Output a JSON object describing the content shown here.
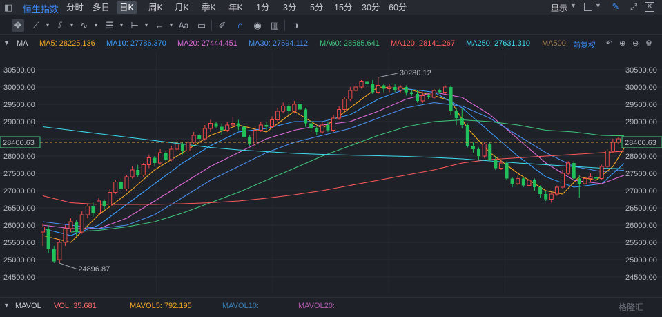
{
  "topbar": {
    "symbol": "恒生指数",
    "tabs": [
      "分时",
      "多日",
      "日K",
      "周K",
      "月K",
      "季K",
      "年K",
      "1分",
      "3分",
      "5分",
      "15分",
      "30分",
      "60分"
    ],
    "active_tab": "日K",
    "display_label": "显示"
  },
  "legend": {
    "ma_label": "MA",
    "ma5": "MA5: 28225.136",
    "ma10": "MA10: 27786.370",
    "ma20": "MA20: 27444.451",
    "ma30": "MA30: 27594.112",
    "ma60": "MA60: 28585.641",
    "ma120": "MA120: 28141.267",
    "ma250": "MA250: 27631.310",
    "ma500": "MA500:",
    "adjust": "前复权",
    "colors": {
      "ma5": "#f5a623",
      "ma10": "#3a9dff",
      "ma20": "#e06ad9",
      "ma30": "#4a8ff0",
      "ma60": "#3ec47a",
      "ma120": "#ff5a5a",
      "ma250": "#3ddcf0",
      "ma500": "#a08050",
      "up": "#ef4a4a",
      "down": "#21c05a",
      "adjust": "#3b8cff"
    }
  },
  "volume_legend": {
    "label": "MAVOL",
    "vol": "VOL: 35.681",
    "mavol5": "MAVOL5: 792.195",
    "mavol10": "MAVOL10:",
    "mavol20": "MAVOL20:"
  },
  "watermark": "格隆汇",
  "chart_data": {
    "type": "candlestick",
    "y_ticks": [
      "30500.00",
      "30000.00",
      "29500.00",
      "29000.00",
      "28500.00",
      "28000.00",
      "27500.00",
      "27000.00",
      "26500.00",
      "26000.00",
      "25500.00",
      "25000.00",
      "24500.00"
    ],
    "ylim": [
      24300,
      30700
    ],
    "current_price": "28400.63",
    "high_label": "30280.12",
    "low_label": "24896.87",
    "candles": [
      [
        25800,
        25950,
        25400,
        26050
      ],
      [
        25900,
        25300,
        25200,
        26000
      ],
      [
        25300,
        24950,
        24900,
        25400
      ],
      [
        25000,
        25500,
        24896.87,
        25600
      ],
      [
        25500,
        25900,
        25400,
        26000
      ],
      [
        25900,
        26100,
        25800,
        26200
      ],
      [
        26100,
        25800,
        25700,
        26150
      ],
      [
        25800,
        26300,
        25750,
        26400
      ],
      [
        26300,
        26550,
        26200,
        26600
      ],
      [
        26550,
        26350,
        26250,
        26650
      ],
      [
        26350,
        26700,
        26300,
        26800
      ],
      [
        26700,
        26550,
        26450,
        26750
      ],
      [
        26550,
        26950,
        26500,
        27050
      ],
      [
        26950,
        27250,
        26900,
        27300
      ],
      [
        27250,
        27050,
        26950,
        27350
      ],
      [
        27050,
        27400,
        27000,
        27450
      ],
      [
        27400,
        27600,
        27350,
        27700
      ],
      [
        27600,
        27450,
        27400,
        27750
      ],
      [
        27450,
        27750,
        27400,
        27800
      ],
      [
        27750,
        27950,
        27650,
        28050
      ],
      [
        27950,
        27800,
        27700,
        28000
      ],
      [
        27800,
        28100,
        27750,
        28200
      ],
      [
        28100,
        27900,
        27850,
        28150
      ],
      [
        27900,
        28200,
        27850,
        28300
      ],
      [
        28200,
        28350,
        28150,
        28450
      ],
      [
        28350,
        28150,
        28050,
        28400
      ],
      [
        28150,
        28400,
        28100,
        28500
      ],
      [
        28400,
        28600,
        28350,
        28700
      ],
      [
        28600,
        28500,
        28400,
        28650
      ],
      [
        28500,
        28800,
        28450,
        28900
      ],
      [
        28800,
        28950,
        28700,
        29050
      ],
      [
        28950,
        28850,
        28800,
        29000
      ],
      [
        28850,
        28750,
        28600,
        28950
      ],
      [
        28750,
        28900,
        28700,
        29000
      ],
      [
        28900,
        28950,
        28850,
        29150
      ],
      [
        28950,
        28850,
        28750,
        29050
      ],
      [
        28850,
        28550,
        28500,
        28900
      ],
      [
        28550,
        28350,
        28300,
        28600
      ],
      [
        28350,
        28750,
        28300,
        28850
      ],
      [
        28750,
        28900,
        28700,
        29000
      ],
      [
        28900,
        28850,
        28750,
        29000
      ],
      [
        28850,
        29050,
        28800,
        29150
      ],
      [
        29050,
        29300,
        29000,
        29400
      ],
      [
        29300,
        29450,
        29250,
        29550
      ],
      [
        29450,
        29300,
        29200,
        29500
      ],
      [
        29300,
        29500,
        29250,
        29600
      ],
      [
        29500,
        29350,
        29050,
        29550
      ],
      [
        29350,
        28950,
        28850,
        29400
      ],
      [
        28950,
        28800,
        28700,
        29050
      ],
      [
        28800,
        28700,
        28600,
        28850
      ],
      [
        28700,
        28900,
        28650,
        29000
      ],
      [
        28900,
        28750,
        28700,
        29000
      ],
      [
        28750,
        29100,
        28700,
        29200
      ],
      [
        29100,
        29350,
        29050,
        29450
      ],
      [
        29350,
        29650,
        29300,
        29700
      ],
      [
        29650,
        29900,
        29600,
        30000
      ],
      [
        29900,
        30000,
        29850,
        30100
      ],
      [
        30000,
        30150,
        29950,
        30200
      ],
      [
        30150,
        30100,
        30050,
        30250
      ],
      [
        30100,
        29850,
        29800,
        30200
      ],
      [
        29850,
        30050,
        29800,
        30280.12
      ],
      [
        30050,
        29950,
        29850,
        30100
      ],
      [
        29950,
        30000,
        29850,
        30100
      ],
      [
        30000,
        29900,
        29850,
        30100
      ],
      [
        29900,
        30000,
        29850,
        30050
      ],
      [
        30000,
        29850,
        29750,
        30050
      ],
      [
        29850,
        29800,
        29750,
        29900
      ],
      [
        29800,
        29600,
        29550,
        29900
      ],
      [
        29600,
        29750,
        29550,
        29850
      ],
      [
        29750,
        29700,
        29650,
        29800
      ],
      [
        29700,
        29900,
        29650,
        29950
      ],
      [
        29900,
        29850,
        29800,
        29950
      ],
      [
        29850,
        30000,
        29800,
        30050
      ],
      [
        30000,
        29300,
        29200,
        30050
      ],
      [
        29300,
        29100,
        28900,
        29400
      ],
      [
        29100,
        28900,
        28800,
        29400
      ],
      [
        28900,
        28300,
        28250,
        28950
      ],
      [
        28300,
        28200,
        28100,
        28400
      ],
      [
        28200,
        28000,
        27900,
        28250
      ],
      [
        28000,
        28350,
        27950,
        28400
      ],
      [
        28350,
        27900,
        27850,
        28400
      ],
      [
        27900,
        27650,
        27600,
        28000
      ],
      [
        27650,
        27800,
        27600,
        27900
      ],
      [
        27800,
        27350,
        27300,
        27850
      ],
      [
        27350,
        27200,
        27100,
        27400
      ],
      [
        27200,
        27350,
        27150,
        27450
      ],
      [
        27350,
        27150,
        27100,
        27400
      ],
      [
        27150,
        27300,
        27100,
        27350
      ],
      [
        27300,
        27100,
        27000,
        27350
      ],
      [
        27100,
        26900,
        26800,
        27150
      ],
      [
        26900,
        26750,
        26700,
        27000
      ],
      [
        26750,
        26900,
        26650,
        26950
      ],
      [
        26900,
        27100,
        26850,
        27150
      ],
      [
        27100,
        27500,
        27050,
        27600
      ],
      [
        27500,
        27800,
        27450,
        27850
      ],
      [
        27800,
        27350,
        27300,
        27850
      ],
      [
        27350,
        27200,
        26800,
        27450
      ],
      [
        27200,
        27350,
        27150,
        27400
      ],
      [
        27350,
        27400,
        27250,
        27500
      ],
      [
        27400,
        27350,
        27300,
        27450
      ],
      [
        27350,
        27700,
        27300,
        27750
      ],
      [
        27700,
        28150,
        27650,
        28200
      ],
      [
        28150,
        28400,
        28100,
        28500
      ],
      [
        28400,
        28500,
        28350,
        28550
      ]
    ],
    "ma_series": {
      "ma5": [
        [
          0,
          25700
        ],
        [
          5,
          25500
        ],
        [
          10,
          26300
        ],
        [
          15,
          26900
        ],
        [
          20,
          27600
        ],
        [
          25,
          28100
        ],
        [
          30,
          28600
        ],
        [
          35,
          28900
        ],
        [
          40,
          28700
        ],
        [
          45,
          29300
        ],
        [
          50,
          28800
        ],
        [
          55,
          29400
        ],
        [
          60,
          30000
        ],
        [
          65,
          29950
        ],
        [
          70,
          29750
        ],
        [
          73,
          29600
        ],
        [
          76,
          28800
        ],
        [
          80,
          28100
        ],
        [
          85,
          27500
        ],
        [
          90,
          27000
        ],
        [
          93,
          26900
        ],
        [
          96,
          27400
        ],
        [
          99,
          27300
        ],
        [
          102,
          27700
        ],
        [
          104,
          28225.136
        ]
      ],
      "ma10": [
        [
          0,
          25900
        ],
        [
          5,
          25700
        ],
        [
          10,
          26000
        ],
        [
          15,
          26600
        ],
        [
          20,
          27200
        ],
        [
          25,
          27800
        ],
        [
          30,
          28300
        ],
        [
          35,
          28700
        ],
        [
          40,
          28800
        ],
        [
          45,
          29000
        ],
        [
          50,
          29000
        ],
        [
          55,
          29200
        ],
        [
          60,
          29650
        ],
        [
          65,
          29950
        ],
        [
          70,
          29850
        ],
        [
          75,
          29400
        ],
        [
          80,
          28700
        ],
        [
          85,
          28000
        ],
        [
          90,
          27400
        ],
        [
          95,
          27100
        ],
        [
          100,
          27200
        ],
        [
          104,
          27786.37
        ]
      ],
      "ma20": [
        [
          0,
          26000
        ],
        [
          5,
          25900
        ],
        [
          10,
          25900
        ],
        [
          15,
          26200
        ],
        [
          20,
          26700
        ],
        [
          25,
          27200
        ],
        [
          30,
          27700
        ],
        [
          35,
          28100
        ],
        [
          40,
          28500
        ],
        [
          45,
          28750
        ],
        [
          50,
          28900
        ],
        [
          55,
          29000
        ],
        [
          60,
          29300
        ],
        [
          65,
          29650
        ],
        [
          70,
          29850
        ],
        [
          75,
          29700
        ],
        [
          80,
          29200
        ],
        [
          85,
          28500
        ],
        [
          90,
          27800
        ],
        [
          95,
          27300
        ],
        [
          100,
          27200
        ],
        [
          104,
          27444.451
        ]
      ],
      "ma30": [
        [
          0,
          26100
        ],
        [
          5,
          26000
        ],
        [
          10,
          25900
        ],
        [
          15,
          26000
        ],
        [
          20,
          26300
        ],
        [
          25,
          26800
        ],
        [
          30,
          27300
        ],
        [
          35,
          27700
        ],
        [
          40,
          28100
        ],
        [
          45,
          28400
        ],
        [
          50,
          28600
        ],
        [
          55,
          28800
        ],
        [
          60,
          29100
        ],
        [
          65,
          29400
        ],
        [
          70,
          29550
        ],
        [
          75,
          29450
        ],
        [
          80,
          29100
        ],
        [
          85,
          28600
        ],
        [
          90,
          28100
        ],
        [
          95,
          27700
        ],
        [
          100,
          27550
        ],
        [
          104,
          27594.112
        ]
      ],
      "ma60": [
        [
          5,
          25800
        ],
        [
          10,
          25850
        ],
        [
          15,
          25950
        ],
        [
          20,
          26100
        ],
        [
          25,
          26350
        ],
        [
          30,
          26650
        ],
        [
          35,
          26950
        ],
        [
          40,
          27300
        ],
        [
          45,
          27650
        ],
        [
          50,
          28000
        ],
        [
          55,
          28300
        ],
        [
          60,
          28600
        ],
        [
          65,
          28850
        ],
        [
          70,
          29000
        ],
        [
          75,
          29050
        ],
        [
          80,
          29000
        ],
        [
          85,
          28900
        ],
        [
          90,
          28750
        ],
        [
          95,
          28700
        ],
        [
          100,
          28600
        ],
        [
          104,
          28585.641
        ]
      ],
      "ma120": [
        [
          0,
          26850
        ],
        [
          5,
          26650
        ],
        [
          10,
          26600
        ],
        [
          15,
          26600
        ],
        [
          20,
          26600
        ],
        [
          25,
          26620
        ],
        [
          30,
          26650
        ],
        [
          35,
          26700
        ],
        [
          40,
          26780
        ],
        [
          45,
          26880
        ],
        [
          50,
          27000
        ],
        [
          55,
          27150
        ],
        [
          60,
          27300
        ],
        [
          65,
          27450
        ],
        [
          70,
          27600
        ],
        [
          75,
          27800
        ],
        [
          80,
          27900
        ],
        [
          85,
          27950
        ],
        [
          90,
          28000
        ],
        [
          95,
          28050
        ],
        [
          100,
          28100
        ],
        [
          104,
          28141.267
        ]
      ],
      "ma250": [
        [
          0,
          28850
        ],
        [
          5,
          28750
        ],
        [
          10,
          28650
        ],
        [
          15,
          28550
        ],
        [
          20,
          28450
        ],
        [
          25,
          28350
        ],
        [
          30,
          28250
        ],
        [
          35,
          28180
        ],
        [
          40,
          28130
        ],
        [
          45,
          28080
        ],
        [
          50,
          28050
        ],
        [
          55,
          28030
        ],
        [
          60,
          28010
        ],
        [
          65,
          27990
        ],
        [
          70,
          27960
        ],
        [
          75,
          27920
        ],
        [
          80,
          27860
        ],
        [
          85,
          27800
        ],
        [
          90,
          27750
        ],
        [
          95,
          27700
        ],
        [
          100,
          27650
        ],
        [
          104,
          27631.31
        ]
      ]
    }
  }
}
